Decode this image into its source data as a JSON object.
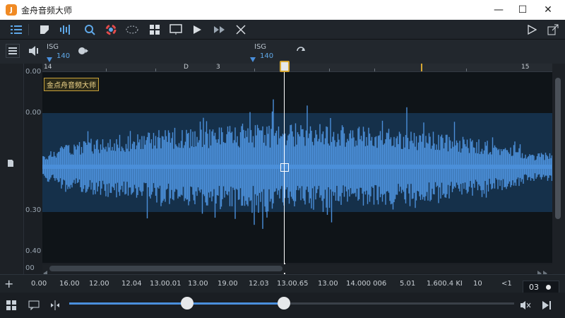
{
  "window": {
    "title": "金舟音频大师",
    "logo_glyph": "J",
    "minimize_glyph": "—",
    "maximize_glyph": "☐",
    "close_glyph": "✕"
  },
  "toolbar": {
    "icons": [
      "list-icon",
      "crop-icon",
      "waveform-icon",
      "zoom-icon",
      "color-wheel-icon",
      "select-ellipse-icon",
      "grid-icon",
      "monitor-icon",
      "play-icon",
      "fast-forward-icon",
      "cross-icon"
    ],
    "right_icons": [
      "play-outline-icon",
      "export-icon"
    ]
  },
  "subbar": {
    "volume_left_label": "ISG",
    "volume_left_value": "140",
    "volume_center_label": "ISG",
    "volume_center_value": "140"
  },
  "ruler": {
    "labels": [
      {
        "text": "14"
      },
      {
        "text": "D"
      },
      {
        "text": "3"
      },
      {
        "text": "15"
      }
    ]
  },
  "axis": {
    "y_labels": [
      "0.00",
      "0.00",
      "0.30",
      "0.40",
      "00"
    ]
  },
  "track": {
    "label": "金点舟音频大师"
  },
  "timeline": {
    "labels": [
      "0.00",
      "16.00",
      "12.00",
      "12.04",
      "13.00.01",
      "13.00",
      "19.00",
      "12.03",
      "13.00.65",
      "13.00",
      "14.000 006",
      "5.01",
      "1.600.4 KI",
      "10",
      "<1"
    ]
  },
  "counter": {
    "value": "03"
  },
  "slider": {
    "fill_fraction": 0.48,
    "knob1_fraction": 0.265,
    "knob2_fraction": 0.483
  },
  "colors": {
    "wave": "#4b8fd9",
    "accent": "#4a8fdc",
    "playhead": "#ffffff",
    "marker": "#d6a733"
  }
}
